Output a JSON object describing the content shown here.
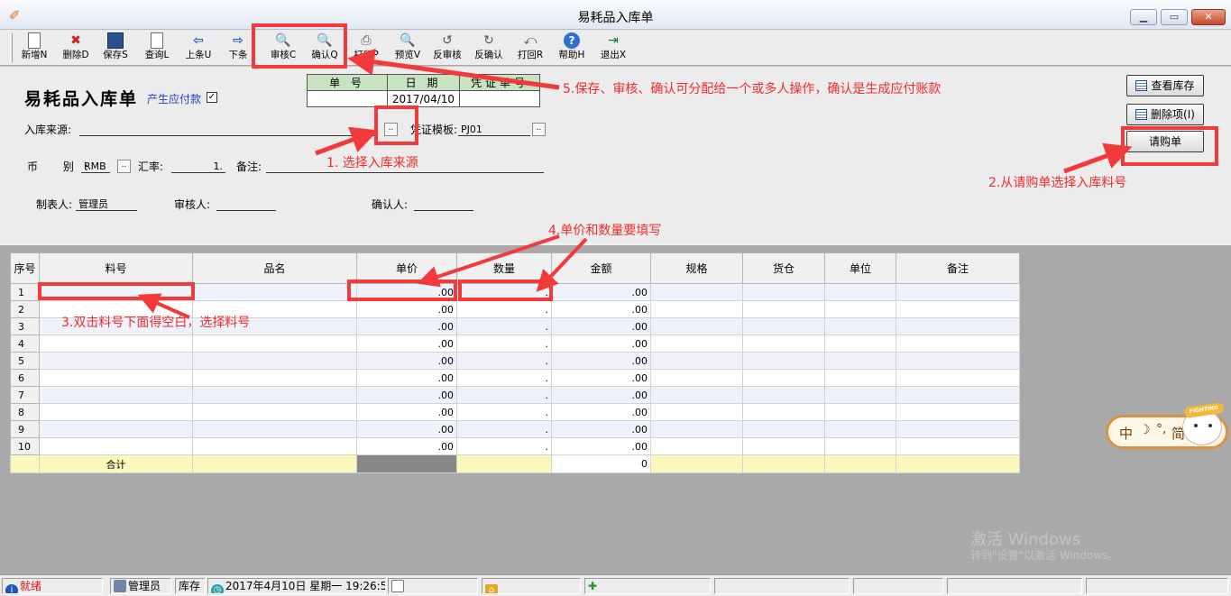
{
  "window": {
    "title": "易耗品入库单"
  },
  "toolbar": [
    {
      "label": "新增N",
      "icon": "new-doc-icon",
      "cls": "ic-doc",
      "glyph": ""
    },
    {
      "label": "删除D",
      "icon": "delete-x-icon",
      "cls": "ic-x",
      "glyph": "✖"
    },
    {
      "label": "保存S",
      "icon": "save-disk-icon",
      "cls": "ic-save",
      "glyph": ""
    },
    {
      "label": "查询L",
      "icon": "query-doc-icon",
      "cls": "ic-doc",
      "glyph": ""
    },
    {
      "label": "上条U",
      "icon": "arrow-left-icon",
      "cls": "ic-blue",
      "glyph": "⇦"
    },
    {
      "label": "下条",
      "icon": "arrow-right-icon",
      "cls": "ic-blue",
      "glyph": "⇨"
    },
    {
      "label": "审核C",
      "icon": "magnifier-icon",
      "cls": "ic-mag",
      "glyph": "🔍"
    },
    {
      "label": "确认Q",
      "icon": "magnifier-icon",
      "cls": "ic-mag",
      "glyph": "🔍"
    },
    {
      "label": "打印P",
      "icon": "printer-icon",
      "cls": "ic-print",
      "glyph": "⎙"
    },
    {
      "label": "预览V",
      "icon": "preview-magnifier-icon",
      "cls": "ic-mag",
      "glyph": "🔍"
    },
    {
      "label": "反审核",
      "icon": "unaudit-icon",
      "cls": "ic-print",
      "glyph": "↺"
    },
    {
      "label": "反确认",
      "icon": "unconfirm-icon",
      "cls": "ic-print",
      "glyph": "↻"
    },
    {
      "label": "打回R",
      "icon": "reject-icon",
      "cls": "ic-print",
      "glyph": "⤺"
    },
    {
      "label": "帮助H",
      "icon": "help-icon",
      "cls": "ic-help",
      "glyph": "?"
    },
    {
      "label": "退出X",
      "icon": "exit-door-icon",
      "cls": "ic-exit",
      "glyph": "⇥"
    }
  ],
  "form": {
    "title": "易耗品入库单",
    "generate_payable_label": "产生应付款",
    "generate_payable_checked": "✓",
    "header_table": {
      "cols": [
        "单 号",
        "日 期",
        "凭证单号"
      ],
      "values": [
        "",
        "2017/04/10",
        ""
      ]
    },
    "source_label": "入库来源:",
    "source_value": "",
    "voucher_template_label": "凭证模板:",
    "voucher_template_value": "PJ01",
    "currency_label": "币 别:",
    "currency_value": "RMB",
    "rate_label": "汇率:",
    "rate_value": "1.",
    "note_label": "备注:",
    "note_value": "",
    "maker_label": "制表人:",
    "maker_value": "管理员",
    "auditor_label": "审核人:",
    "auditor_value": "",
    "confirmer_label": "确认人:",
    "confirmer_value": "",
    "buttons": {
      "view_stock": "查看库存",
      "delete_item": "删除项(I)",
      "purchase_request": "请购单"
    },
    "ellipsis": ".."
  },
  "grid": {
    "columns": [
      "序号",
      "料号",
      "品名",
      "单价",
      "数量",
      "金额",
      "规格",
      "货仓",
      "单位",
      "备注"
    ],
    "rows": [
      {
        "seq": "1",
        "price": ".00",
        "qty": ".",
        "amount": ".00"
      },
      {
        "seq": "2",
        "price": ".00",
        "qty": ".",
        "amount": ".00"
      },
      {
        "seq": "3",
        "price": ".00",
        "qty": ".",
        "amount": ".00"
      },
      {
        "seq": "4",
        "price": ".00",
        "qty": ".",
        "amount": ".00"
      },
      {
        "seq": "5",
        "price": ".00",
        "qty": ".",
        "amount": ".00"
      },
      {
        "seq": "6",
        "price": ".00",
        "qty": ".",
        "amount": ".00"
      },
      {
        "seq": "7",
        "price": ".00",
        "qty": ".",
        "amount": ".00"
      },
      {
        "seq": "8",
        "price": ".00",
        "qty": ".",
        "amount": ".00"
      },
      {
        "seq": "9",
        "price": ".00",
        "qty": ".",
        "amount": ".00"
      },
      {
        "seq": "10",
        "price": ".00",
        "qty": ".",
        "amount": ".00"
      }
    ],
    "total_label": "合计",
    "total_amount": "0"
  },
  "annotations": {
    "a1": "1. 选择入库来源",
    "a2": "2.从请购单选择入库料号",
    "a3": "3.双击料号下面得空白，选择料号",
    "a4": "4.单价和数量要填写",
    "a5": "5.保存、审核、确认可分配给一个或多人操作，确认是生成应付账款"
  },
  "statusbar": {
    "state": "就绪",
    "user": "管理员",
    "module": "库存",
    "datetime": "2017年4月10日 星期一 19:26:58"
  },
  "ime": {
    "lang": "中",
    "moon": "☽",
    "punct": "°,",
    "mode": "简",
    "mascot_band": "FIGHTING"
  },
  "watermark": {
    "line1": "激活 Windows",
    "line2": "转到\"设置\"以激活 Windows。"
  },
  "colors": {
    "annotation_red": "#f23a3a",
    "header_green": "#c7e3c1",
    "total_yellow": "#fcf8bd",
    "odd_row": "#eff1fb"
  }
}
